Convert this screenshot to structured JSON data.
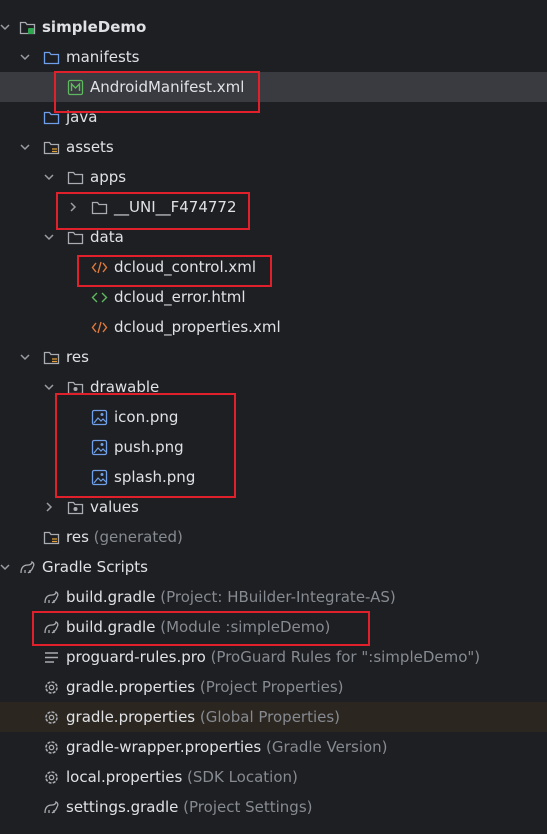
{
  "tree": {
    "root": {
      "label": "simpleDemo"
    },
    "manifests": {
      "label": "manifests"
    },
    "android_manifest": {
      "label": "AndroidManifest.xml"
    },
    "java": {
      "label": "java"
    },
    "assets": {
      "label": "assets"
    },
    "apps": {
      "label": "apps"
    },
    "uni_folder": {
      "label": "__UNI__F474772"
    },
    "data": {
      "label": "data"
    },
    "dcloud_control": {
      "label": "dcloud_control.xml"
    },
    "dcloud_error": {
      "label": "dcloud_error.html"
    },
    "dcloud_properties": {
      "label": "dcloud_properties.xml"
    },
    "res": {
      "label": "res"
    },
    "drawable": {
      "label": "drawable"
    },
    "icon_png": {
      "label": "icon.png"
    },
    "push_png": {
      "label": "push.png"
    },
    "splash_png": {
      "label": "splash.png"
    },
    "values": {
      "label": "values"
    },
    "res_generated": {
      "label": "res",
      "hint": "(generated)"
    },
    "gradle_scripts": {
      "label": "Gradle Scripts"
    },
    "build_gradle_project": {
      "label": "build.gradle",
      "hint": "(Project: HBuilder-Integrate-AS)"
    },
    "build_gradle_module": {
      "label": "build.gradle",
      "hint": "(Module :simpleDemo)"
    },
    "proguard": {
      "label": "proguard-rules.pro",
      "hint": "(ProGuard Rules for \":simpleDemo\")"
    },
    "gradle_props_project": {
      "label": "gradle.properties",
      "hint": "(Project Properties)"
    },
    "gradle_props_global": {
      "label": "gradle.properties",
      "hint": "(Global Properties)"
    },
    "gradle_wrapper": {
      "label": "gradle-wrapper.properties",
      "hint": "(Gradle Version)"
    },
    "local_props": {
      "label": "local.properties",
      "hint": "(SDK Location)"
    },
    "settings_gradle": {
      "label": "settings.gradle",
      "hint": "(Project Settings)"
    }
  },
  "icons": {
    "folder": "folder-icon",
    "module": "module-folder-icon",
    "resource": "resource-folder-icon",
    "manifest": "manifest-icon",
    "xml": "xml-file-icon",
    "html": "html-file-icon",
    "image": "image-file-icon",
    "gradle": "gradle-icon",
    "settings": "gear-icon",
    "text": "text-file-icon"
  },
  "colors": {
    "background": "#1e1f22",
    "text": "#dfe1e5",
    "hint": "#868a91",
    "selected_row": "#393b40",
    "highlight_box": "#e0202a",
    "folder_icon": "#6f9fe8",
    "xml_icon": "#e07a3c",
    "html_icon": "#5fb85f",
    "manifest_icon": "#5fb85f"
  }
}
